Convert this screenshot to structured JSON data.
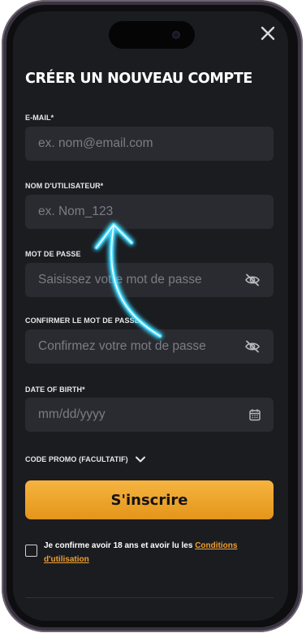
{
  "form": {
    "title": "CRÉER UN NOUVEAU COMPTE",
    "email": {
      "label": "E-MAIL*",
      "placeholder": "ex. nom@email.com"
    },
    "username": {
      "label": "NOM D'UTILISATEUR*",
      "placeholder": "ex. Nom_123"
    },
    "password": {
      "label": "MOT DE PASSE",
      "placeholder": "Saisissez votre mot de passe"
    },
    "confirm": {
      "label": "CONFIRMER LE MOT DE PASSE",
      "placeholder": "Confirmez votre mot de passe"
    },
    "dob": {
      "label": "DATE OF BIRTH*",
      "placeholder": "mm/dd/yyyy"
    },
    "promo": {
      "label": "CODE PROMO (FACULTATIF)"
    },
    "submit_label": "S'inscrire",
    "consent": {
      "text": "Je confirme avoir 18 ans et avoir lu les ",
      "link": "Conditions d'utilisation"
    }
  },
  "icons": {
    "close": "close-icon",
    "password_toggle": "eye-slash-icon",
    "calendar": "calendar-icon",
    "promo_toggle": "chevron-down-icon",
    "annotation": "curved-arrow"
  },
  "colors": {
    "background": "#1b1c20",
    "input": "#2a2b30",
    "accent": "#f0a030",
    "arrow_glow": "#3fd8ff"
  }
}
